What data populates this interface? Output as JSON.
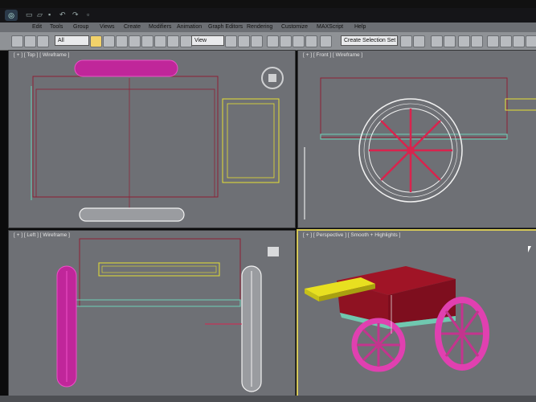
{
  "menu": [
    "Edit",
    "Tools",
    "Group",
    "Views",
    "Create",
    "Modifiers",
    "Animation",
    "Graph Editors",
    "Rendering",
    "Customize",
    "MAXScript",
    "Help"
  ],
  "toolbar": {
    "filter_dropdown": "All",
    "reference_dropdown": "View",
    "selection_set": "Create Selection Set"
  },
  "viewports": {
    "top": "[ + ] [ Top ] [ Wireframe ]",
    "front": "[ + ] [ Front ] [ Wireframe ]",
    "left": "[ + ] [ Left ] [ Wireframe ]",
    "perspective": "[ + ] [ Perspective ] [ Smooth + Highlights ]"
  },
  "colors": {
    "wire_red": "#8e1f35",
    "wheel_magenta": "#e040b0",
    "body_red": "#8b1020",
    "platform_yellow": "#e8e020",
    "base_teal": "#70c8b0",
    "wire_white": "#f2f2f2",
    "active_border": "#d5c858"
  }
}
